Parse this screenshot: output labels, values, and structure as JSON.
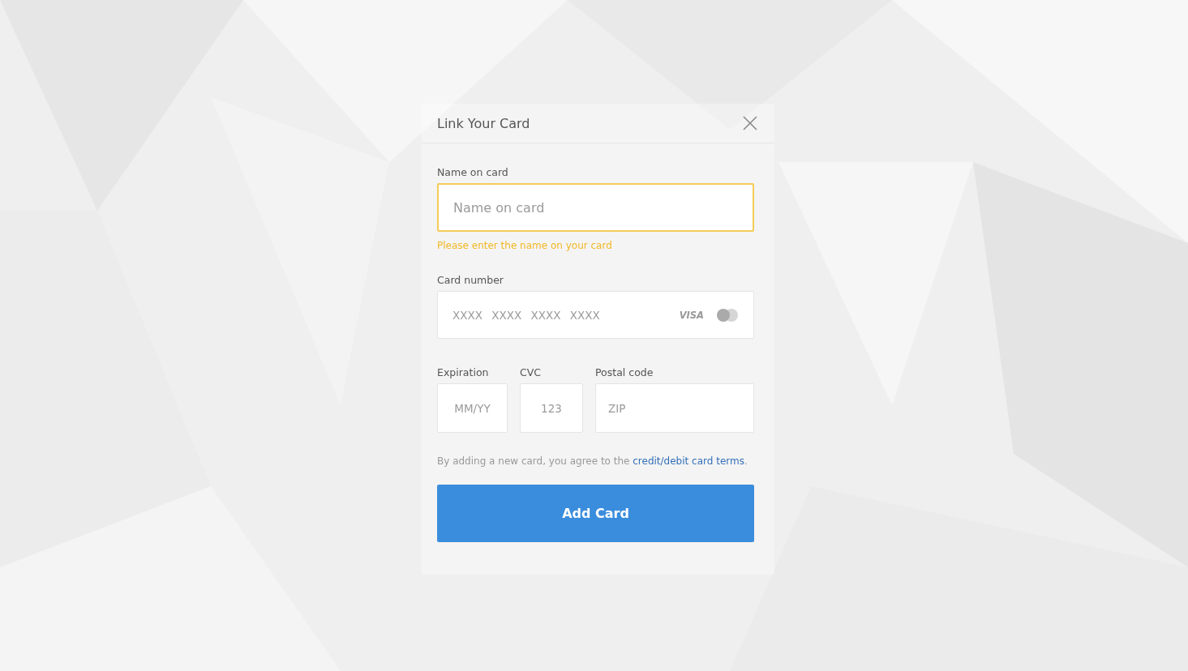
{
  "dialog": {
    "title": "Link Your Card"
  },
  "fields": [
    {
      "kind": "text",
      "label": "Name on card",
      "placeholder": "Name on card",
      "invalid": true,
      "error": "Please enter the name on your card"
    },
    {
      "kind": "card",
      "label": "Card number",
      "placeholder": "XXXX XXXX XXXX XXXX",
      "brand": "VISA",
      "invalid": false
    }
  ],
  "row_fields": [
    {
      "label": "Expiration",
      "placeholder": "MM/YY",
      "invalid": false
    },
    {
      "label": "CVC",
      "placeholder": "123",
      "invalid": false
    },
    {
      "label": "Postal code",
      "placeholder": "ZIP",
      "invalid": false
    }
  ],
  "terms": {
    "text": "By adding a new card, you agree to the ",
    "link": "credit/debit card terms",
    "end": "."
  },
  "submit": "Add Card"
}
